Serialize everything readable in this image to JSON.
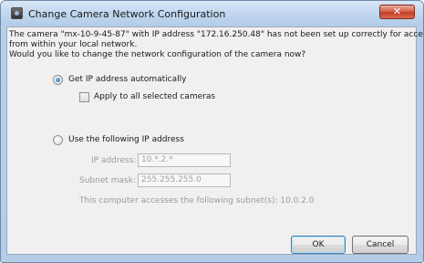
{
  "window": {
    "title": "Change Camera Network Configuration"
  },
  "message": {
    "line1": "The camera \"mx-10-9-45-87\" with IP address \"172.16.250.48\" has not been set up correctly for access",
    "line2": "from within your local network.",
    "line3": "Would you like to change the network configuration of the camera now?"
  },
  "options": {
    "auto": {
      "label": "Get IP address automatically",
      "checked": true
    },
    "apply_all": {
      "label": "Apply to all selected cameras",
      "checked": false
    },
    "manual": {
      "label": "Use the following IP address",
      "checked": false
    }
  },
  "fields": {
    "ip": {
      "label": "IP address:",
      "value": "10.*.2.*"
    },
    "subnet": {
      "label": "Subnet mask:",
      "value": "255.255.255.0"
    }
  },
  "subnet_info": "This computer accesses the following subnet(s): 10.0.2.0",
  "buttons": {
    "ok": "OK",
    "cancel": "Cancel"
  },
  "colors": {
    "title_bar": "#c2d8f0",
    "close_button": "#c43c26",
    "dialog_bg": "#f0f0f0",
    "radio_dot": "#1d5d9b"
  }
}
